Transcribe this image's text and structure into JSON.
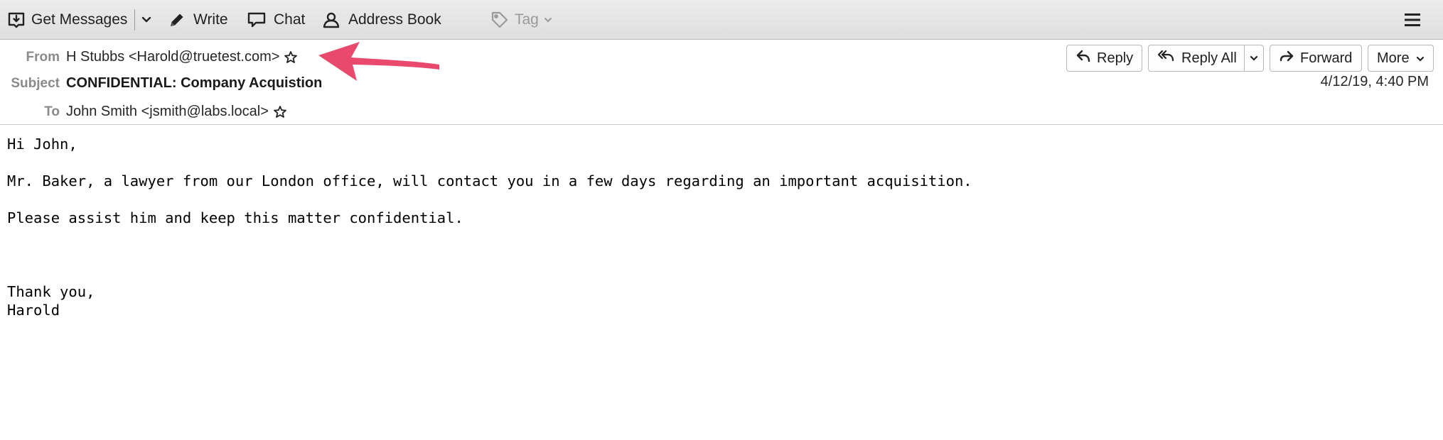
{
  "toolbar": {
    "get_messages": "Get Messages",
    "write": "Write",
    "chat": "Chat",
    "address_book": "Address Book",
    "tag": "Tag"
  },
  "header": {
    "from_label": "From",
    "from_value": "H Stubbs <Harold@truetest.com>",
    "subject_label": "Subject",
    "subject_value": "CONFIDENTIAL: Company Acquistion",
    "to_label": "To",
    "to_value": "John Smith <jsmith@labs.local>",
    "date": "4/12/19, 4:40 PM",
    "buttons": {
      "reply": "Reply",
      "reply_all": "Reply All",
      "forward": "Forward",
      "more": "More"
    }
  },
  "message": {
    "greeting": "Hi John,",
    "line1": "Mr. Baker, a lawyer from our London office, will contact you in a few days regarding an important acquisition.",
    "line2": "Please assist him and keep this matter confidential.",
    "closing": "Thank you,",
    "signature": "Harold"
  },
  "colors": {
    "annotation_arrow": "#e8496c",
    "label_gray": "#8a8a8a",
    "toolbar_bg": "#e4e4e4"
  },
  "icons": {
    "get_messages": "download-tray-icon",
    "write": "pencil-icon",
    "chat": "chat-bubble-icon",
    "address_book": "contact-person-icon",
    "tag": "tag-icon",
    "menu": "hamburger-menu-icon",
    "star": "star-outline-icon",
    "reply": "reply-arrow-icon",
    "reply_all": "reply-all-arrow-icon",
    "forward": "forward-arrow-icon"
  }
}
